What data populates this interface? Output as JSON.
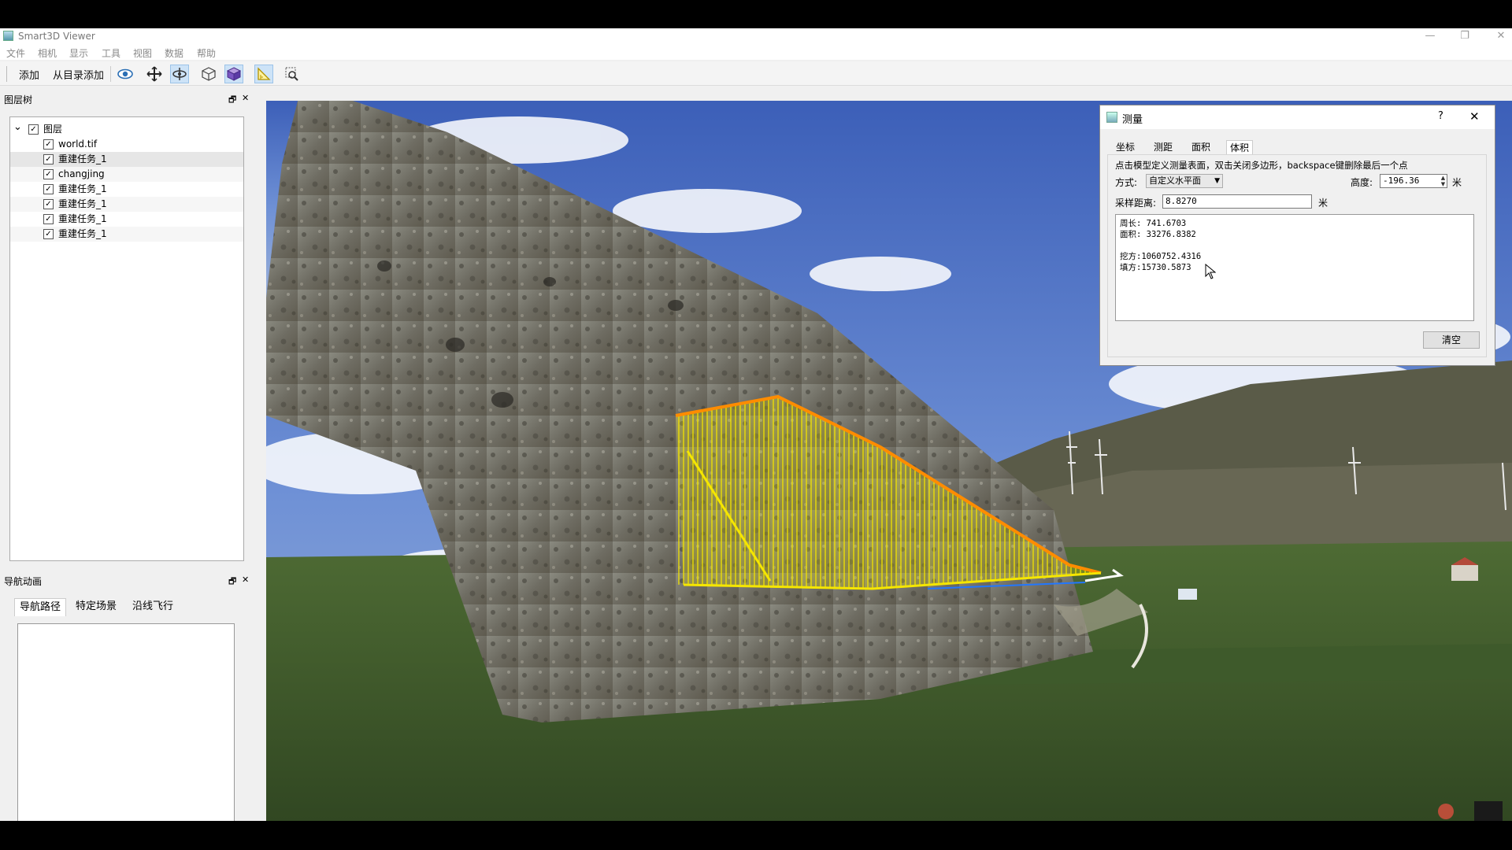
{
  "app": {
    "title": "Smart3D Viewer"
  },
  "window_controls": {
    "minimize": "—",
    "restore": "❐",
    "close": "✕"
  },
  "menu": [
    "文件",
    "相机",
    "显示",
    "工具",
    "视图",
    "数据",
    "帮助"
  ],
  "toolbar": {
    "add_label": "添加",
    "add_from_dir_label": "从目录添加",
    "icons": [
      "eye-icon",
      "move-cross-icon",
      "orbit-icon",
      "wireframe-cube-icon",
      "solid-cube-icon",
      "measure-ruler-icon",
      "zoom-fit-icon"
    ]
  },
  "layer_panel": {
    "title": "图层树",
    "float_btn": "🗗",
    "close_btn": "✕",
    "root": {
      "label": "图层",
      "expander": "⌄"
    },
    "items": [
      {
        "label": "world.tif"
      },
      {
        "label": "重建任务_1"
      },
      {
        "label": "changjing"
      },
      {
        "label": "重建任务_1"
      },
      {
        "label": "重建任务_1"
      },
      {
        "label": "重建任务_1"
      },
      {
        "label": "重建任务_1"
      }
    ],
    "check_mark": "✓"
  },
  "nav_panel": {
    "title": "导航动画",
    "float_btn": "🗗",
    "close_btn": "✕",
    "tabs": [
      "导航路径",
      "特定场景",
      "沿线飞行"
    ]
  },
  "collapse_tab": "⌄",
  "measure_dialog": {
    "title": "测量",
    "help": "?",
    "close": "✕",
    "tabs": [
      "坐标",
      "测距",
      "面积",
      "体积"
    ],
    "active_tab": "体积",
    "instruction": "点击模型定义测量表面，双击关闭多边形，backspace键删除最后一个点",
    "mode_label": "方式:",
    "mode_value": "自定义水平面",
    "height_label": "高度:",
    "height_value": "-196.36",
    "height_unit": "米",
    "sample_label": "采样距离:",
    "sample_value": "8.8270",
    "sample_unit": "米",
    "results": {
      "perimeter": "周长: 741.6703",
      "area": "面积: 33276.8382",
      "cut": "挖方:1060752.4316",
      "fill": "填方:15730.5873"
    },
    "clear_label": "清空"
  },
  "colors": {
    "measure_fill": "#f5e600",
    "measure_edge": "#ff8c00",
    "sky": "#4f74c8",
    "ground": "#3f5b2c"
  }
}
